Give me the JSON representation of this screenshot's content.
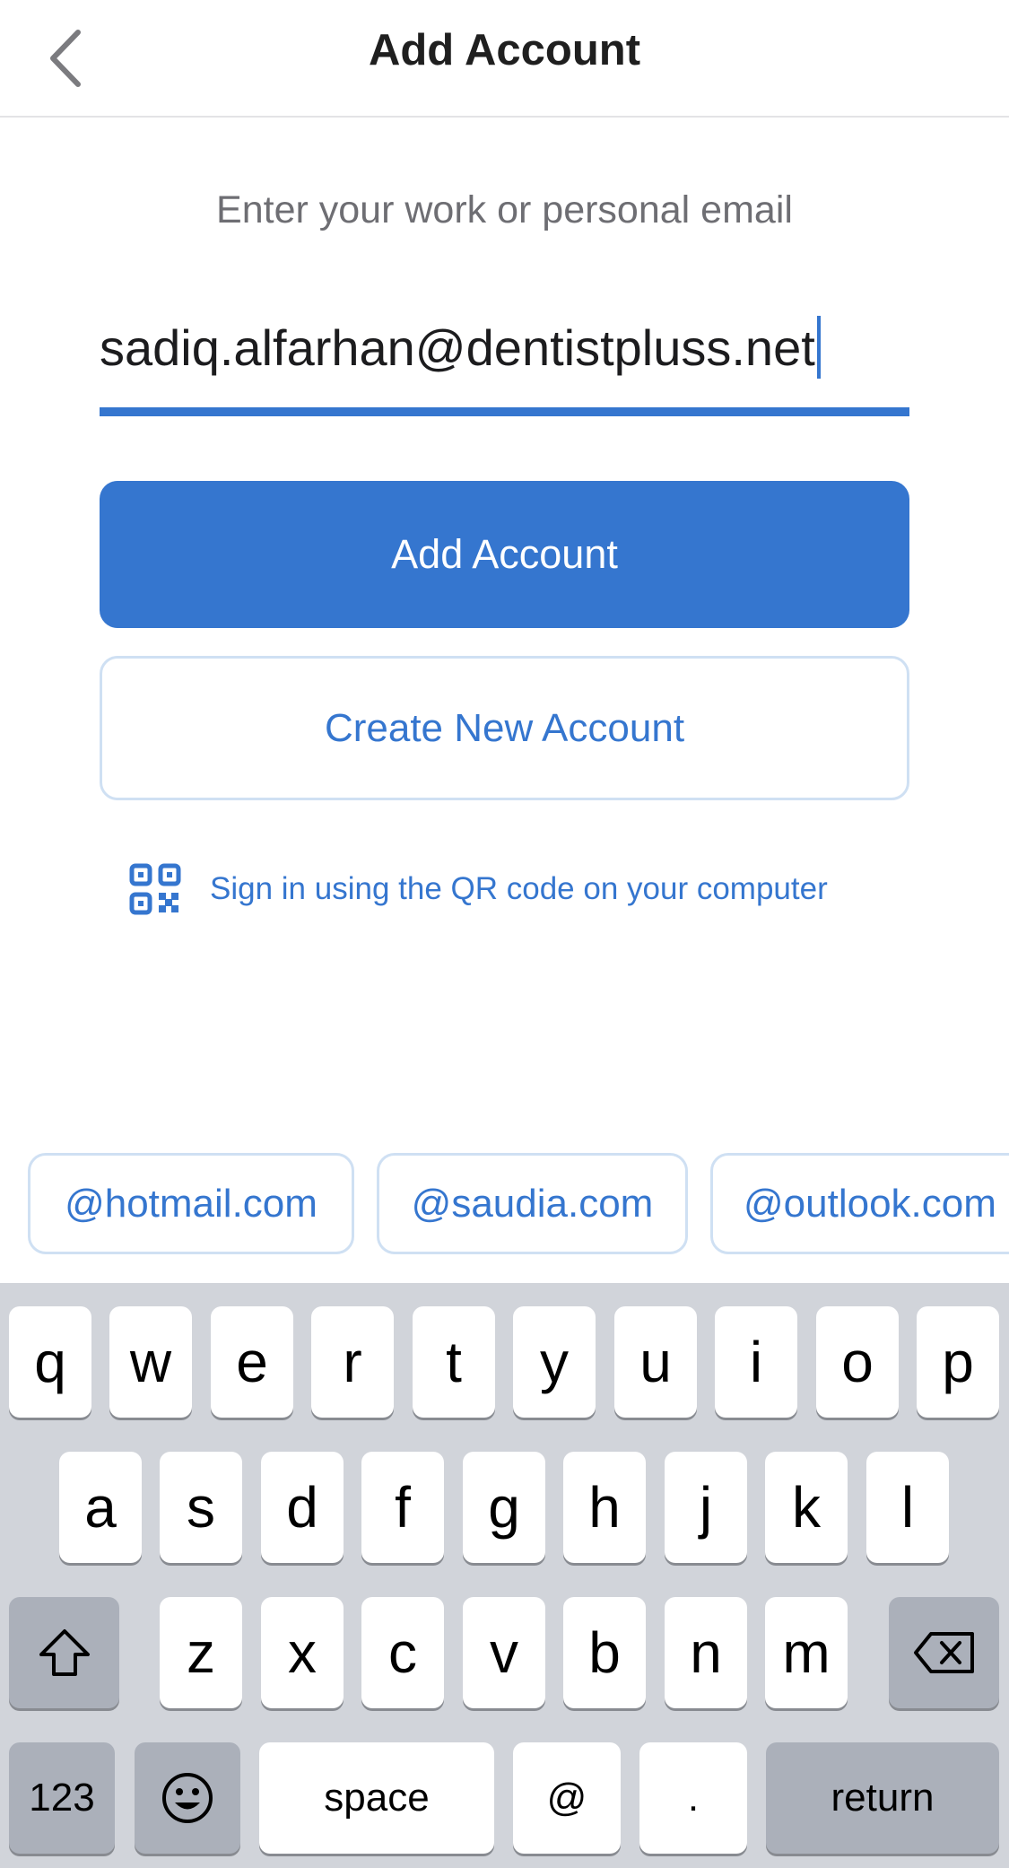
{
  "header": {
    "title": "Add Account"
  },
  "prompt": "Enter your work or personal email",
  "email_field": {
    "value": "sadiq.alfarhan@dentistpluss.net"
  },
  "buttons": {
    "add_account": "Add Account",
    "create_account": "Create New Account"
  },
  "qr_link": {
    "text": "Sign in using the QR code on your computer",
    "icon": "qr-code-icon"
  },
  "domain_suggestions": [
    "@hotmail.com",
    "@saudia.com",
    "@outlook.com"
  ],
  "keyboard": {
    "row1": [
      "q",
      "w",
      "e",
      "r",
      "t",
      "y",
      "u",
      "i",
      "o",
      "p"
    ],
    "row2": [
      "a",
      "s",
      "d",
      "f",
      "g",
      "h",
      "j",
      "k",
      "l"
    ],
    "row3": [
      "z",
      "x",
      "c",
      "v",
      "b",
      "n",
      "m"
    ],
    "numbers": "123",
    "space": "space",
    "at": "@",
    "dot": ".",
    "return": "return"
  },
  "colors": {
    "accent": "#3576cf",
    "keyboard_bg": "#d1d4da",
    "dark_key": "#abb0ba"
  }
}
